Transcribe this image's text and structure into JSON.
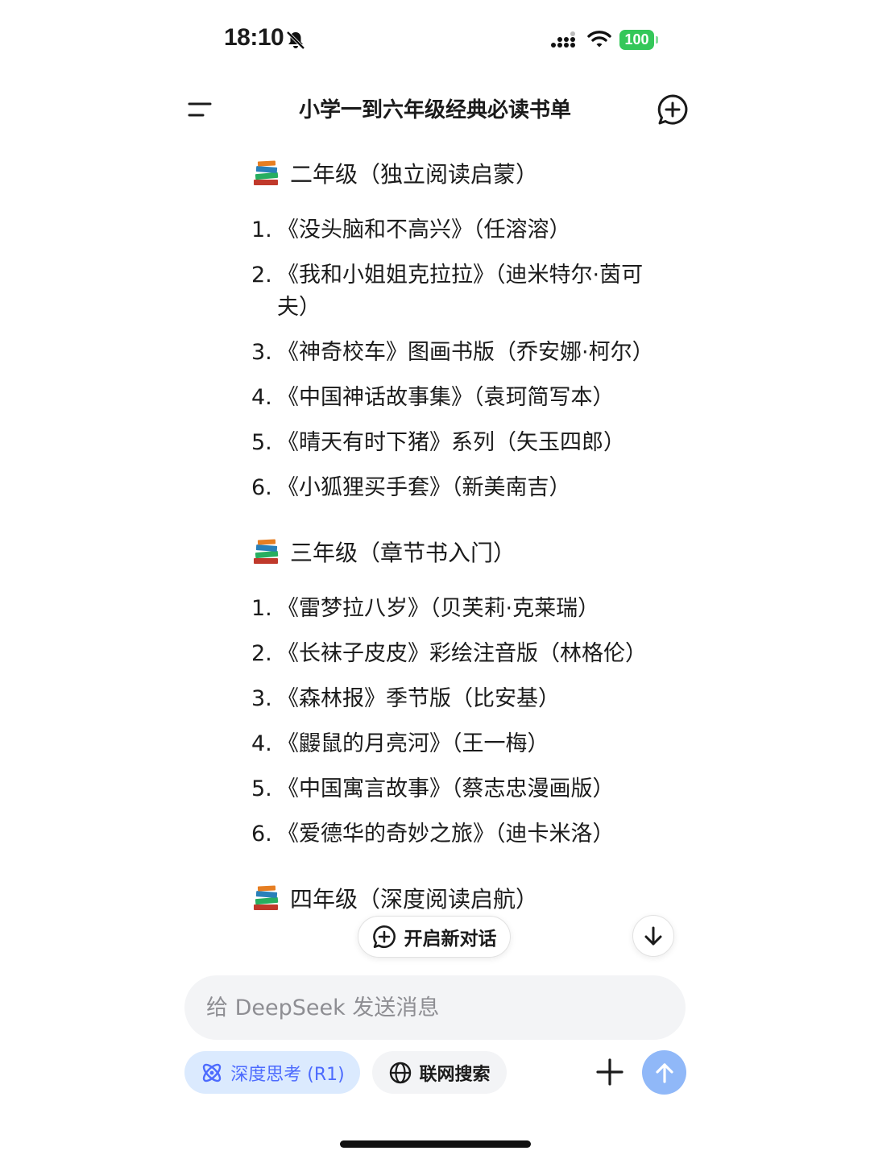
{
  "status_bar": {
    "time": "18:10",
    "battery": "100"
  },
  "header": {
    "title": "小学一到六年级经典必读书单"
  },
  "grades": [
    {
      "heading": "二年级（独立阅读启蒙）",
      "books": [
        {
          "num": "1.",
          "text": "《没头脑和不高兴》（任溶溶）"
        },
        {
          "num": "2.",
          "text": "《我和小姐姐克拉拉》（迪米特尔·茵可夫）"
        },
        {
          "num": "3.",
          "text": "《神奇校车》图画书版（乔安娜·柯尔）"
        },
        {
          "num": "4.",
          "text": "《中国神话故事集》（袁珂简写本）"
        },
        {
          "num": "5.",
          "text": "《晴天有时下猪》系列（矢玉四郎）"
        },
        {
          "num": "6.",
          "text": "《小狐狸买手套》（新美南吉）"
        }
      ]
    },
    {
      "heading": "三年级（章节书入门）",
      "books": [
        {
          "num": "1.",
          "text": "《雷梦拉八岁》（贝芙莉·克莱瑞）"
        },
        {
          "num": "2.",
          "text": "《长袜子皮皮》彩绘注音版（林格伦）"
        },
        {
          "num": "3.",
          "text": "《森林报》季节版（比安基）"
        },
        {
          "num": "4.",
          "text": "《鼹鼠的月亮河》（王一梅）"
        },
        {
          "num": "5.",
          "text": "《中国寓言故事》（蔡志忠漫画版）"
        },
        {
          "num": "6.",
          "text": "《爱德华的奇妙之旅》（迪卡米洛）"
        }
      ]
    },
    {
      "heading": "四年级（深度阅读启航）",
      "books": []
    }
  ],
  "floating": {
    "new_chat_label": "开启新对话"
  },
  "input": {
    "placeholder": "给 DeepSeek 发送消息"
  },
  "toolbar": {
    "deep_think_label": "深度思考 (R1)",
    "web_search_label": "联网搜索"
  },
  "colors": {
    "accent": "#4d6bfe",
    "accent_bg": "#dbeafe",
    "send_button": "#90b8f8",
    "battery": "#34c759"
  }
}
